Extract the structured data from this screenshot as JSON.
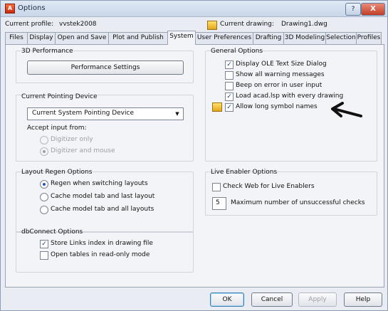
{
  "window": {
    "title": "Options"
  },
  "titlebar": {
    "help": "?",
    "close": "X"
  },
  "profile": {
    "current_profile_label": "Current profile:",
    "current_profile_value": "vvstek2008",
    "current_drawing_label": "Current drawing:",
    "current_drawing_value": "Drawing1.dwg"
  },
  "tabs": [
    "Files",
    "Display",
    "Open and Save",
    "Plot and Publish",
    "System",
    "User Preferences",
    "Drafting",
    "3D Modeling",
    "Selection",
    "Profiles"
  ],
  "active_tab": "System",
  "performance": {
    "title": "3D Performance",
    "button": "Performance Settings"
  },
  "pointing": {
    "title": "Current Pointing Device",
    "device": "Current System Pointing Device",
    "accept_label": "Accept input from:",
    "options": [
      {
        "label": "Digitizer only",
        "selected": false,
        "enabled": false
      },
      {
        "label": "Digitizer and mouse",
        "selected": true,
        "enabled": false
      }
    ]
  },
  "regen": {
    "title": "Layout Regen Options",
    "options": [
      {
        "label": "Regen when switching layouts",
        "selected": true
      },
      {
        "label": "Cache model tab and last layout",
        "selected": false
      },
      {
        "label": "Cache model tab and all layouts",
        "selected": false
      }
    ]
  },
  "dbconnect": {
    "title": "dbConnect Options",
    "options": [
      {
        "label": "Store Links index in drawing file",
        "checked": true
      },
      {
        "label": "Open tables in read-only mode",
        "checked": false
      }
    ]
  },
  "general": {
    "title": "General Options",
    "options": [
      {
        "label": "Display OLE Text Size Dialog",
        "checked": true
      },
      {
        "label": "Show all warning messages",
        "checked": false
      },
      {
        "label": "Beep on error in user input",
        "checked": false
      },
      {
        "label": "Load acad.lsp with every drawing",
        "checked": true
      },
      {
        "label": "Allow long symbol names",
        "checked": true
      }
    ]
  },
  "live_enabler": {
    "title": "Live Enabler Options",
    "check_web": "Check Web for Live Enablers",
    "check_web_checked": false,
    "max_value": "5",
    "max_label": "Maximum number of unsuccessful checks"
  },
  "buttons": {
    "ok": "OK",
    "cancel": "Cancel",
    "apply": "Apply",
    "help": "Help"
  },
  "colors": {
    "accent": "#2a56b8",
    "arrow": "#111111"
  }
}
